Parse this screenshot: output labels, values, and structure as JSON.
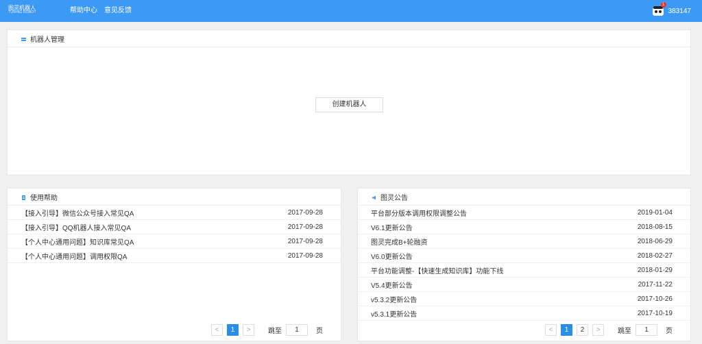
{
  "header": {
    "logo_line1": "图灵机器人",
    "logo_line2": "TURING ROBOT",
    "nav": [
      "帮助中心",
      "意见反馈"
    ],
    "badge": "1",
    "user_id": "383147"
  },
  "robots": {
    "title": "机器人管理",
    "create_label": "创建机器人"
  },
  "help": {
    "title": "使用帮助",
    "items": [
      {
        "title": "【接入引导】微信公众号接入常见QA",
        "date": "2017-09-28"
      },
      {
        "title": "【接入引导】QQ机器人接入常见QA",
        "date": "2017-09-28"
      },
      {
        "title": "【个人中心通用问题】知识库常见QA",
        "date": "2017-09-28"
      },
      {
        "title": "【个人中心通用问题】调用权限QA",
        "date": "2017-09-28"
      }
    ],
    "pager": {
      "prev": "<",
      "pages": [
        "1"
      ],
      "next": ">",
      "jump_label": "跳至",
      "jump_value": "1",
      "page_unit": "页"
    }
  },
  "news": {
    "title": "图灵公告",
    "items": [
      {
        "title": "平台部分版本调用权限调整公告",
        "date": "2019-01-04"
      },
      {
        "title": "V6.1更新公告",
        "date": "2018-08-15"
      },
      {
        "title": "图灵完成B+轮融资",
        "date": "2018-06-29"
      },
      {
        "title": "V6.0更新公告",
        "date": "2018-02-27"
      },
      {
        "title": "平台功能调整-【快速生成知识库】功能下线",
        "date": "2018-01-29"
      },
      {
        "title": "V5.4更新公告",
        "date": "2017-11-22"
      },
      {
        "title": "v5.3.2更新公告",
        "date": "2017-10-26"
      },
      {
        "title": "v5.3.1更新公告",
        "date": "2017-10-19"
      }
    ],
    "pager": {
      "prev": "<",
      "pages": [
        "1",
        "2"
      ],
      "next": ">",
      "jump_label": "跳至",
      "jump_value": "1",
      "page_unit": "页"
    }
  },
  "colors": {
    "header": "#3d9af4",
    "accent": "#2a8de6",
    "badge": "#e33333"
  },
  "icons": [
    "robot-manage-icon",
    "help-doc-icon",
    "announce-icon",
    "user-avatar-icon"
  ]
}
